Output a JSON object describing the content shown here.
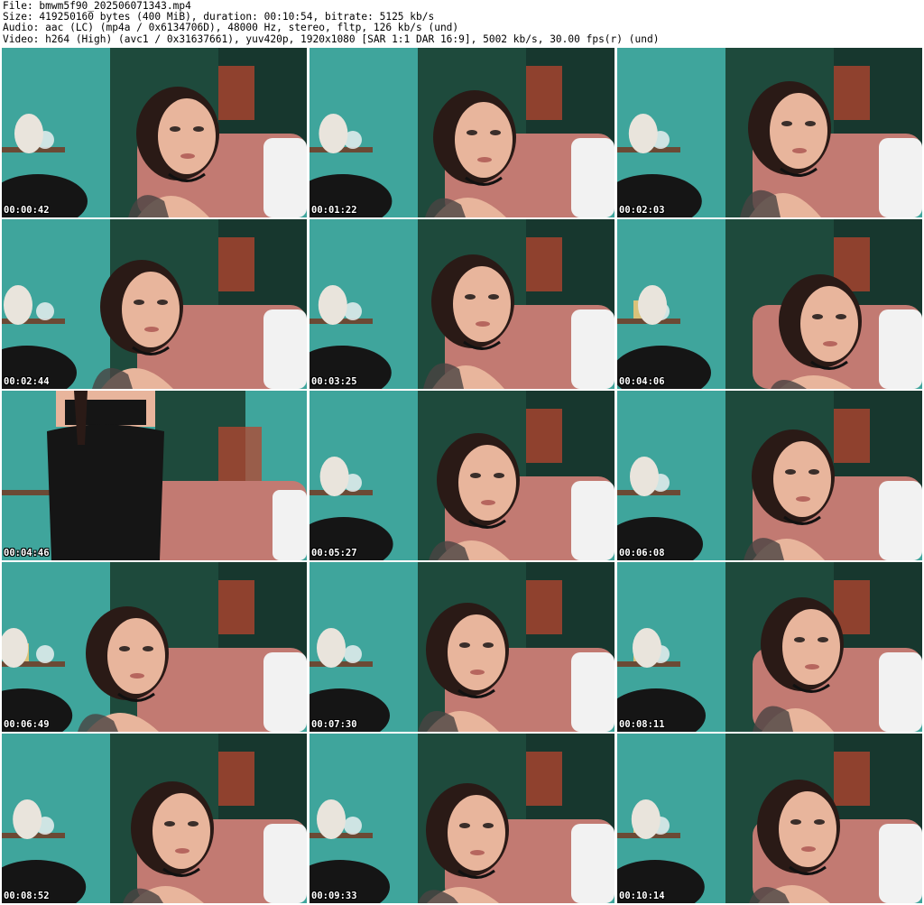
{
  "header": {
    "file_line": "File: bmwm5f90_202506071343.mp4",
    "size_line": "Size: 419250160 bytes (400 MiB), duration: 00:10:54, bitrate: 5125 kb/s",
    "audio_line": "Audio: aac (LC) (mp4a / 0x6134706D), 48000 Hz, stereo, fltp, 126 kb/s (und)",
    "video_line": "Video: h264 (High) (avc1 / 0x31637661), yuv420p, 1920x1080 [SAR 1:1 DAR 16:9], 5002 kb/s, 30.00 fps(r) (und)"
  },
  "thumbnails": [
    {
      "timestamp": "00:00:42",
      "scene": "portrait"
    },
    {
      "timestamp": "00:01:22",
      "scene": "portrait"
    },
    {
      "timestamp": "00:02:03",
      "scene": "portrait"
    },
    {
      "timestamp": "00:02:44",
      "scene": "portrait"
    },
    {
      "timestamp": "00:03:25",
      "scene": "portrait"
    },
    {
      "timestamp": "00:04:06",
      "scene": "portrait"
    },
    {
      "timestamp": "00:04:46",
      "scene": "back-view"
    },
    {
      "timestamp": "00:05:27",
      "scene": "portrait"
    },
    {
      "timestamp": "00:06:08",
      "scene": "portrait"
    },
    {
      "timestamp": "00:06:49",
      "scene": "portrait"
    },
    {
      "timestamp": "00:07:30",
      "scene": "portrait"
    },
    {
      "timestamp": "00:08:11",
      "scene": "portrait"
    },
    {
      "timestamp": "00:08:52",
      "scene": "portrait"
    },
    {
      "timestamp": "00:09:33",
      "scene": "portrait"
    },
    {
      "timestamp": "00:10:14",
      "scene": "portrait"
    }
  ],
  "colors": {
    "wall_teal": "#3fa59c",
    "curtain_green": "#1e4a3c",
    "sofa_pink": "#c27a72",
    "skin": "#e8b59c",
    "hair": "#2a1a16",
    "clothing_black": "#151515",
    "timestamp_text": "#ffffff"
  }
}
